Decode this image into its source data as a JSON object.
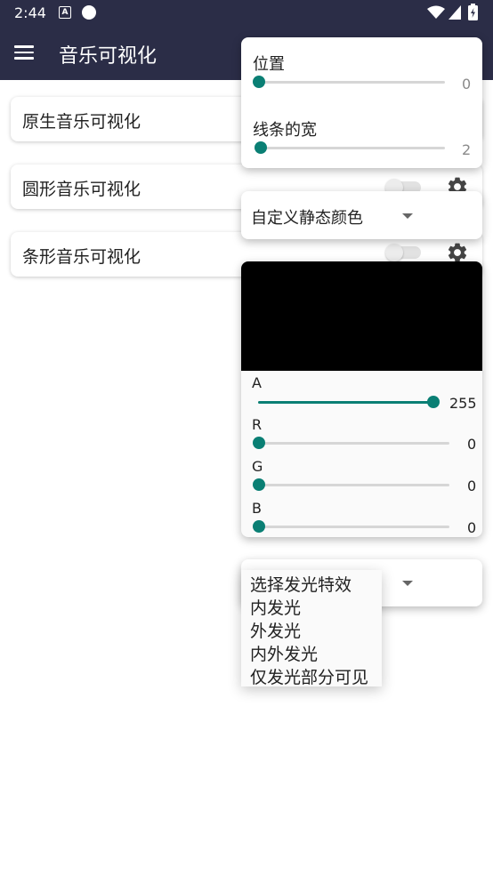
{
  "status_bar": {
    "time": "2:44",
    "notification_letter": "A"
  },
  "app_bar": {
    "title": "音乐可视化"
  },
  "cards": [
    {
      "label": "原生音乐可视化"
    },
    {
      "label": "圆形音乐可视化"
    },
    {
      "label": "条形音乐可视化"
    }
  ],
  "position_popup": {
    "position_label": "位置",
    "position_value": "0",
    "position_fraction": 0,
    "line_width_label": "线条的宽",
    "line_width_value": "2",
    "line_width_fraction": 0
  },
  "color_mode": {
    "selected": "自定义静态颜色"
  },
  "color_picker": {
    "preview_color": "#000000",
    "channels": [
      {
        "label": "A",
        "value": "255",
        "fraction": 1
      },
      {
        "label": "R",
        "value": "0",
        "fraction": 0
      },
      {
        "label": "G",
        "value": "0",
        "fraction": 0
      },
      {
        "label": "B",
        "value": "0",
        "fraction": 0
      }
    ]
  },
  "glow_menu": {
    "options": [
      "选择发光特效",
      "内发光",
      "外发光",
      "内外发光",
      "仅发光部分可见"
    ]
  },
  "colors": {
    "appbar": "#2b2d47",
    "accent": "#0a7f74"
  }
}
